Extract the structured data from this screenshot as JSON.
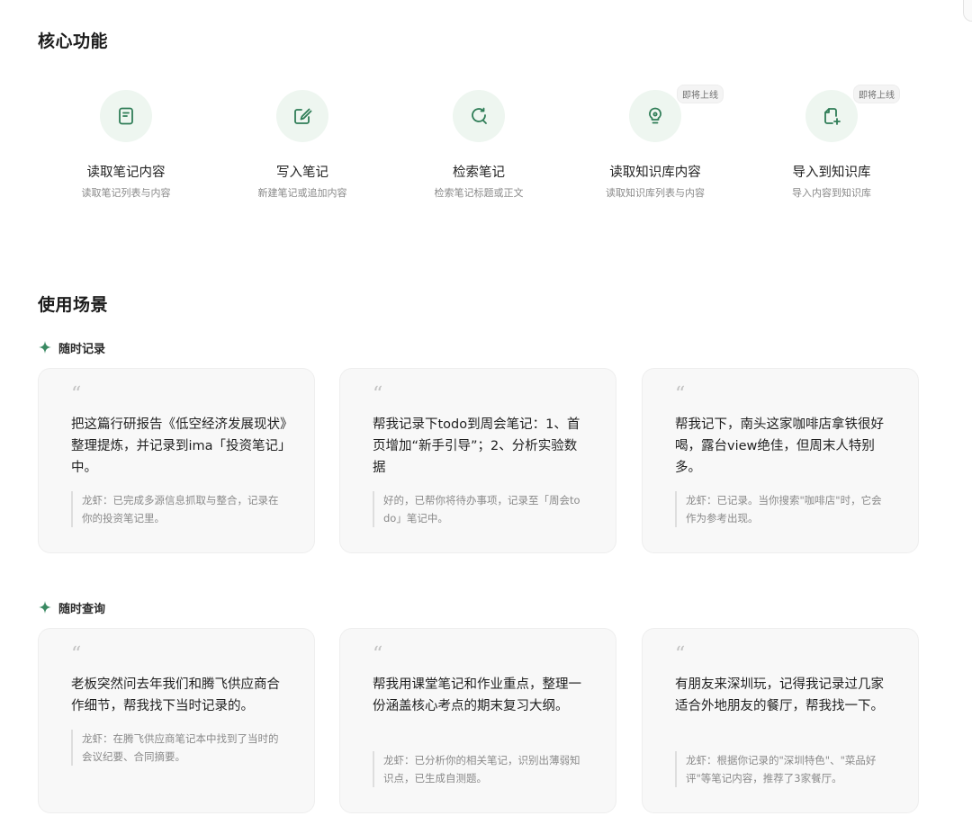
{
  "core_features": {
    "title": "核心功能",
    "items": [
      {
        "name": "读取笔记内容",
        "desc": "读取笔记列表与内容",
        "icon": "note-read-icon",
        "badge": ""
      },
      {
        "name": "写入笔记",
        "desc": "新建笔记或追加内容",
        "icon": "edit-note-icon",
        "badge": ""
      },
      {
        "name": "检索笔记",
        "desc": "检索笔记标题或正文",
        "icon": "search-refresh-icon",
        "badge": ""
      },
      {
        "name": "读取知识库内容",
        "desc": "读取知识库列表与内容",
        "icon": "lightbulb-icon",
        "badge": "即将上线"
      },
      {
        "name": "导入到知识库",
        "desc": "导入内容到知识库",
        "icon": "import-add-icon",
        "badge": "即将上线"
      }
    ]
  },
  "scenarios": {
    "title": "使用场景",
    "groups": [
      {
        "label": "随时记录",
        "cards": [
          {
            "prompt": "把这篇行研报告《低空经济发展现状》整理提炼，并记录到ima「投资笔记」中。",
            "reply": "龙虾：已完成多源信息抓取与整合，记录在你的投资笔记里。"
          },
          {
            "prompt": "帮我记录下todo到周会笔记：1、首页增加“新手引导”；2、分析实验数据",
            "reply": "好的，已帮你将待办事项，记录至「周会todo」笔记中。"
          },
          {
            "prompt": "帮我记下，南头这家咖啡店拿铁很好喝，露台view绝佳，但周末人特别多。",
            "reply": "龙虾：已记录。当你搜索\"咖啡店\"时，它会作为参考出现。"
          }
        ]
      },
      {
        "label": "随时查询",
        "cards": [
          {
            "prompt": "老板突然问去年我们和腾飞供应商合作细节，帮我找下当时记录的。",
            "reply": "龙虾：在腾飞供应商笔记本中找到了当时的会议纪要、合同摘要。"
          },
          {
            "prompt": "帮我用课堂笔记和作业重点，整理一份涵盖核心考点的期末复习大纲。",
            "reply": "龙虾：已分析你的相关笔记，识别出薄弱知识点，已生成自测题。"
          },
          {
            "prompt": "有朋友来深圳玩，记得我记录过几家适合外地朋友的餐厅，帮我找一下。",
            "reply": "龙虾：根据你记录的\"深圳特色\"、\"菜品好评\"等笔记内容，推荐了3家餐厅。"
          }
        ]
      }
    ]
  },
  "colors": {
    "accent": "#2f7d57",
    "icon_bg": "#eef6f0",
    "card_bg": "#f8f8f8"
  },
  "quote_glyph": "“"
}
